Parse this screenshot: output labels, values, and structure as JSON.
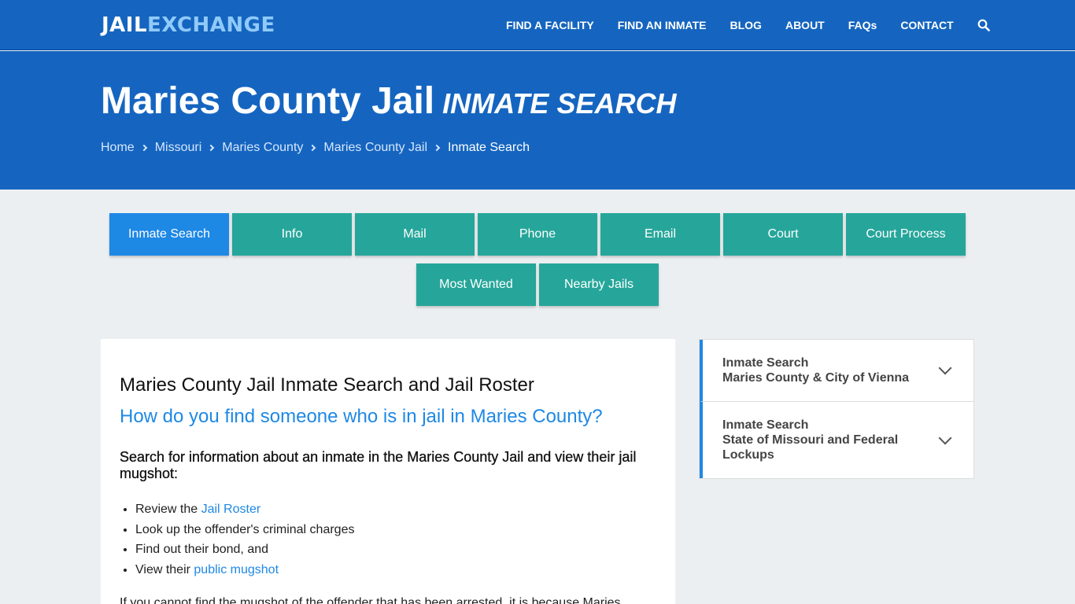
{
  "logo": {
    "part1": "JAIL",
    "part2": "EXCHANGE"
  },
  "nav": {
    "items": [
      "FIND A FACILITY",
      "FIND AN INMATE",
      "BLOG",
      "ABOUT",
      "FAQs",
      "CONTACT"
    ],
    "search_icon": "search-icon"
  },
  "hero": {
    "title": "Maries County Jail",
    "subtitle": "INMATE SEARCH",
    "breadcrumbs": [
      "Home",
      "Missouri",
      "Maries County",
      "Maries County Jail"
    ],
    "current": "Inmate Search"
  },
  "tabs": {
    "row1": [
      "Inmate Search",
      "Info",
      "Mail",
      "Phone",
      "Email",
      "Court",
      "Court Process"
    ],
    "row2": [
      "Most Wanted",
      "Nearby Jails"
    ],
    "active": "Inmate Search"
  },
  "main": {
    "heading": "Maries County Jail Inmate Search and Jail Roster",
    "question": "How do you find someone who is in jail in Maries County?",
    "intro": "Search for information about an inmate in the Maries County Jail and view their jail mugshot:",
    "list": [
      {
        "pre": "Review the ",
        "link": "Jail Roster",
        "post": ""
      },
      {
        "pre": "Look up the offender's criminal charges",
        "link": "",
        "post": ""
      },
      {
        "pre": "Find out their bond, and",
        "link": "",
        "post": ""
      },
      {
        "pre": "View their ",
        "link": "public mugshot",
        "post": ""
      }
    ],
    "paragraph": "If you cannot find the mugshot of the offender that has been arrested, it is because Maries"
  },
  "sidebar": {
    "items": [
      {
        "line1": "Inmate Search",
        "line2": "Maries County & City of Vienna"
      },
      {
        "line1": "Inmate Search",
        "line2": "State of Missouri and Federal Lockups"
      }
    ]
  },
  "colors": {
    "brand_blue": "#1565c0",
    "tab_teal": "#26a69a",
    "tab_active": "#1e88e5",
    "link": "#1e88e5"
  }
}
